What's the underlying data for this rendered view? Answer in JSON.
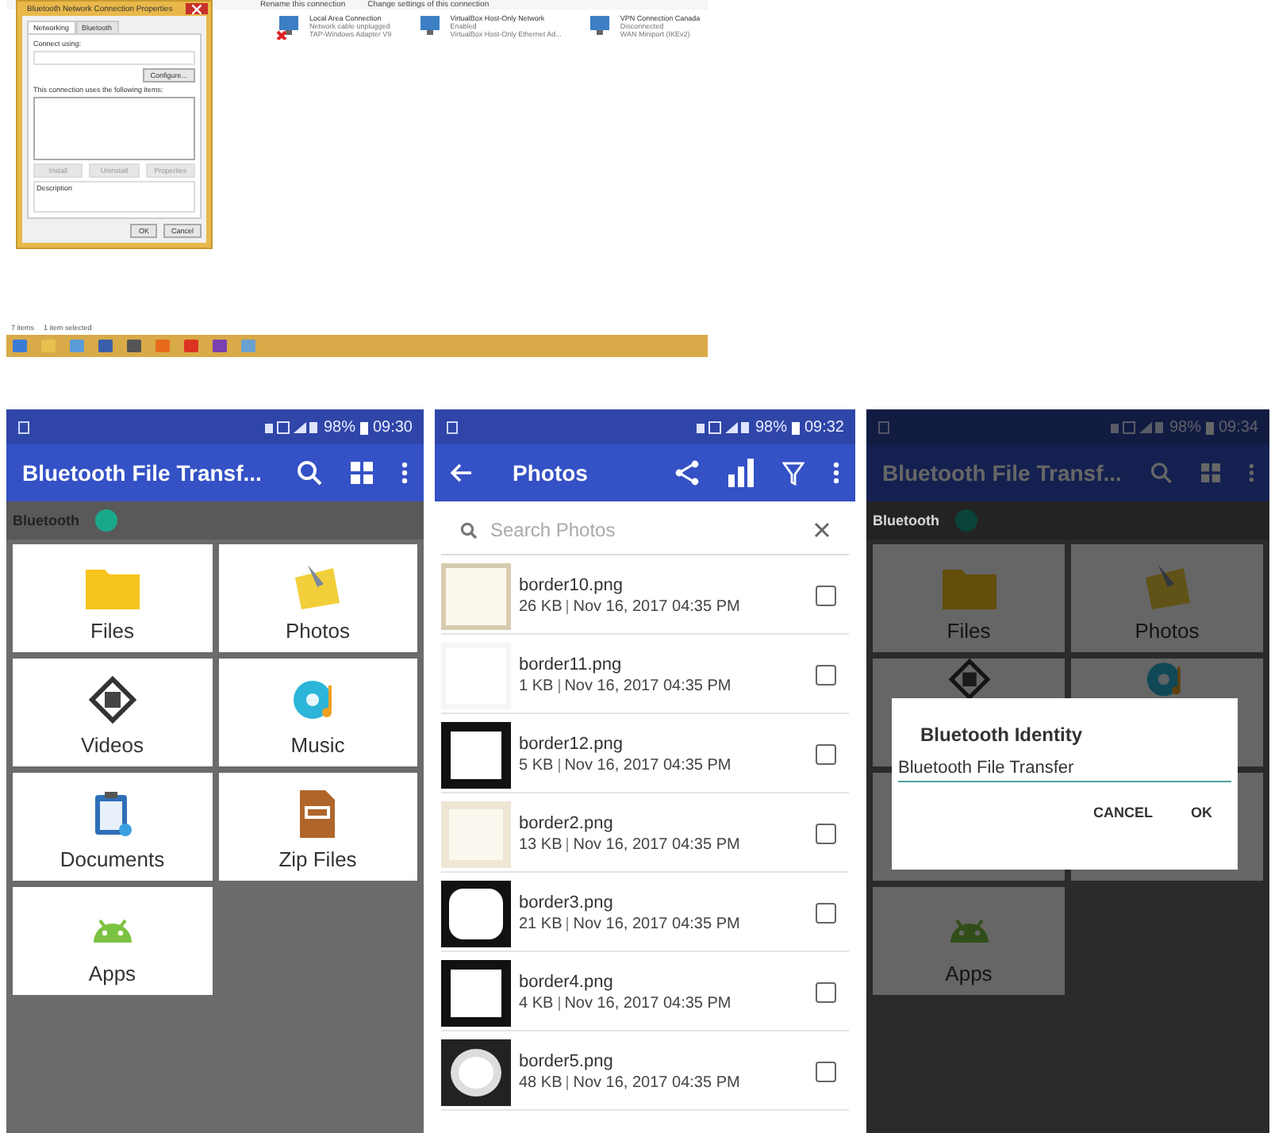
{
  "desktop": {
    "toolbar": [
      "Rename this connection",
      "Change settings of this connection"
    ],
    "connections": [
      {
        "name": "Local Area Connection",
        "status": "Network cable unplugged",
        "adapter": "TAP-Windows Adapter V9",
        "disconnected": true
      },
      {
        "name": "VirtualBox Host-Only Network",
        "status": "Enabled",
        "adapter": "VirtualBox Host-Only Ethernet Ad...",
        "disconnected": false
      },
      {
        "name": "VPN Connection Canada",
        "status": "Disconnected",
        "adapter": "WAN Miniport (IKEv2)",
        "disconnected": false
      }
    ],
    "dialog": {
      "title": "Bluetooth Network Connection Properties",
      "tabs": [
        {
          "label": "Networking",
          "selected": true
        },
        {
          "label": "Bluetooth",
          "selected": false
        }
      ],
      "connect_using": "Connect using:",
      "configure": "Configure...",
      "items_label": "This connection uses the following items:",
      "item_buttons": [
        "Install",
        "Uninstall",
        "Properties"
      ],
      "description": "Description",
      "buttons": [
        "OK",
        "Cancel"
      ]
    },
    "status_bar": [
      "7 items",
      "1 item selected"
    ]
  },
  "phones": [
    {
      "battery": "98%",
      "time": "09:30",
      "title": "Bluetooth File Transf...",
      "bluetooth_label": "Bluetooth",
      "bluetooth_on": true,
      "dimmed": false,
      "tiles": [
        {
          "kind": "files",
          "label": "Files"
        },
        {
          "kind": "photos",
          "label": "Photos"
        },
        {
          "kind": "videos",
          "label": "Videos"
        },
        {
          "kind": "music",
          "label": "Music"
        },
        {
          "kind": "documents",
          "label": "Documents"
        },
        {
          "kind": "zip",
          "label": "Zip Files"
        },
        {
          "kind": "apps",
          "label": "Apps"
        }
      ]
    },
    {
      "battery": "98%",
      "time": "09:32",
      "title": "Photos",
      "search": {
        "placeholder": "Search Photos"
      },
      "photos": [
        {
          "name": "border10.png",
          "size": "26 KB",
          "date": "Nov 16, 2017 04:35 PM",
          "checked": false
        },
        {
          "name": "border11.png",
          "size": "1 KB",
          "date": "Nov 16, 2017 04:35 PM",
          "checked": false
        },
        {
          "name": "border12.png",
          "size": "5 KB",
          "date": "Nov 16, 2017 04:35 PM",
          "checked": false
        },
        {
          "name": "border2.png",
          "size": "13 KB",
          "date": "Nov 16, 2017 04:35 PM",
          "checked": false
        },
        {
          "name": "border3.png",
          "size": "21 KB",
          "date": "Nov 16, 2017 04:35 PM",
          "checked": false
        },
        {
          "name": "border4.png",
          "size": "4 KB",
          "date": "Nov 16, 2017 04:35 PM",
          "checked": false
        },
        {
          "name": "border5.png",
          "size": "48 KB",
          "date": "Nov 16, 2017 04:35 PM",
          "checked": false
        }
      ]
    },
    {
      "battery": "98%",
      "time": "09:34",
      "title": "Bluetooth File Transf...",
      "bluetooth_label": "Bluetooth",
      "bluetooth_on": true,
      "dimmed": true,
      "tiles": [
        {
          "kind": "files",
          "label": "Files"
        },
        {
          "kind": "photos",
          "label": "Photos"
        },
        {
          "kind": "videos"
        },
        {
          "kind": "music"
        },
        {
          "kind": "covered"
        },
        {
          "kind": "covered"
        },
        {
          "kind": "apps",
          "label": "Apps"
        }
      ],
      "dialog": {
        "title": "Bluetooth Identity",
        "value": "Bluetooth File Transfer",
        "buttons": [
          "CANCEL",
          "OK"
        ]
      }
    }
  ]
}
